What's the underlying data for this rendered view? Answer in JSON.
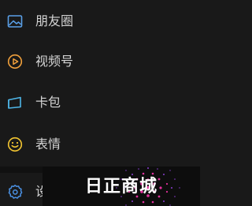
{
  "menu": {
    "items": [
      {
        "label": "朋友圈",
        "icon": "moments-icon",
        "icon_color": "#5aa0e8"
      },
      {
        "label": "视频号",
        "icon": "channels-icon",
        "icon_color": "#f0a03c"
      },
      {
        "label": "卡包",
        "icon": "card-wallet-icon",
        "icon_color": "#4eb6e8"
      },
      {
        "label": "表情",
        "icon": "sticker-icon",
        "icon_color": "#f2c531"
      },
      {
        "label": "设",
        "icon": "settings-icon",
        "icon_color": "#4a90e2"
      }
    ]
  },
  "watermark": {
    "text": "日正商城",
    "accent_color": "#e0309a"
  },
  "colors": {
    "background": "#191919",
    "text": "#d4d4d4"
  }
}
